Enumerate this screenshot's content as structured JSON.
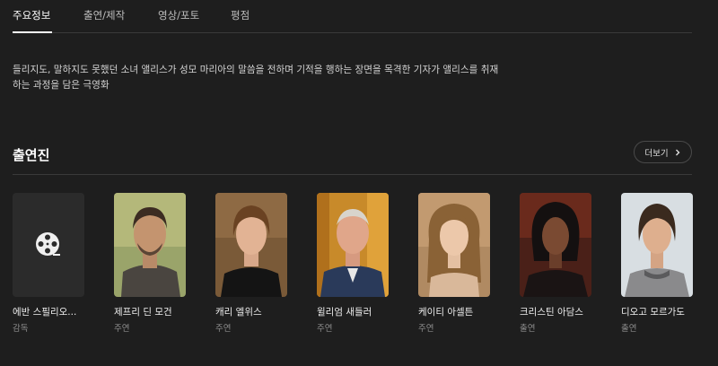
{
  "tabs": [
    {
      "label": "주요정보",
      "active": true
    },
    {
      "label": "출연/제작",
      "active": false
    },
    {
      "label": "영상/포토",
      "active": false
    },
    {
      "label": "평점",
      "active": false
    }
  ],
  "synopsis": {
    "line1": "들리지도, 말하지도 못했던 소녀 앨리스가 성모 마리아의 말씀을 전하며 기적을 행하는 장면을 목격한 기자가 앨리스를 취재",
    "line2": "하는 과정을 담은 극영화"
  },
  "cast_section": {
    "title": "출연진",
    "more_label": "더보기"
  },
  "cast": [
    {
      "name": "에반 스필리오...",
      "role": "감독",
      "photo": "film-reel-icon"
    },
    {
      "name": "제프리 딘 모건",
      "role": "주연",
      "photo": "portrait"
    },
    {
      "name": "캐리 엘위스",
      "role": "주연",
      "photo": "portrait"
    },
    {
      "name": "윌리엄 새들러",
      "role": "주연",
      "photo": "portrait"
    },
    {
      "name": "케이티 아셀튼",
      "role": "주연",
      "photo": "portrait"
    },
    {
      "name": "크리스틴 아담스",
      "role": "출연",
      "photo": "portrait"
    },
    {
      "name": "디오고 모르가도",
      "role": "출연",
      "photo": "portrait"
    }
  ],
  "colors": {
    "background": "#1e1e1e",
    "divider": "#3a3a3a",
    "active_tab": "#ffffff"
  }
}
